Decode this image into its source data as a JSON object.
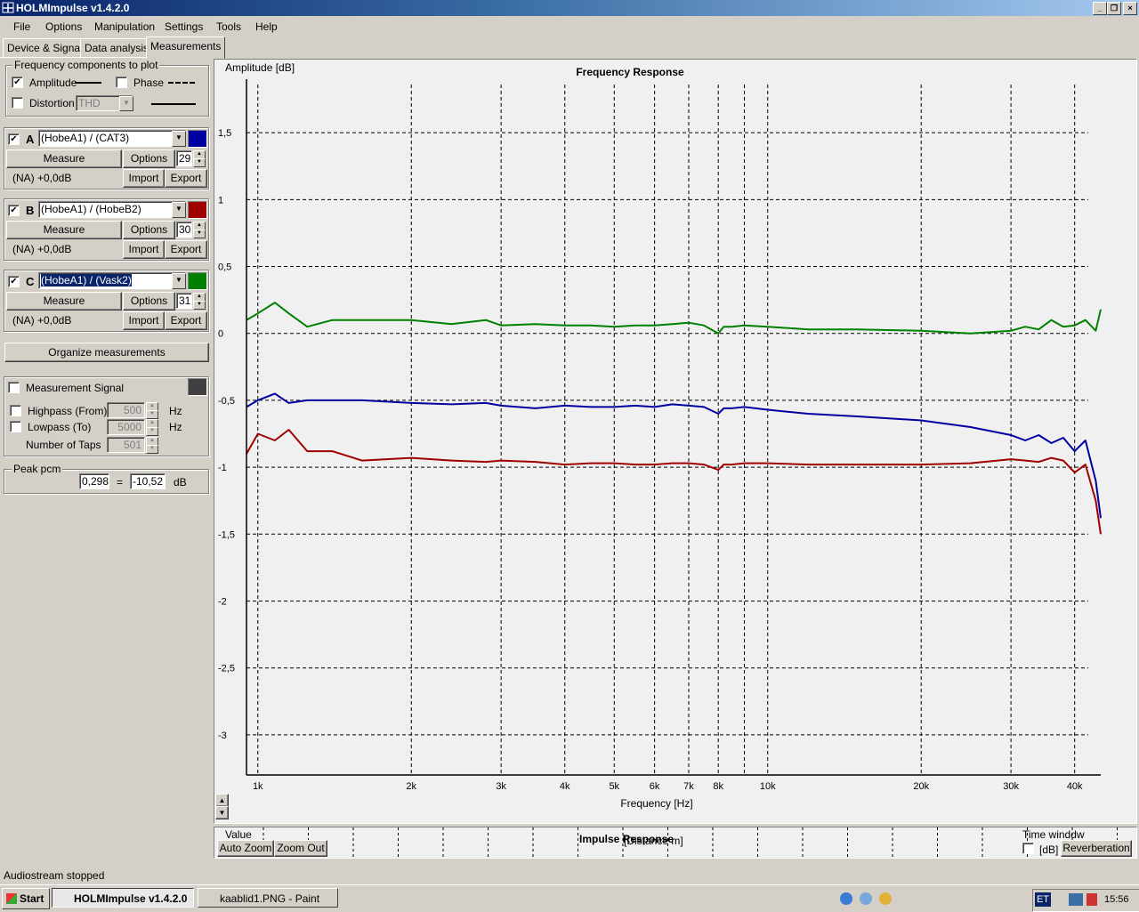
{
  "window": {
    "title": "HOLMImpulse  v1.4.2.0"
  },
  "menu": [
    "File",
    "Options",
    "Manipulation",
    "Settings",
    "Tools",
    "Help"
  ],
  "tabs": [
    "Device & Signal",
    "Data analysis",
    "Measurements"
  ],
  "freq_components": {
    "legend": "Frequency components to plot",
    "amplitude_label": "Amplitude",
    "amplitude_checked": true,
    "phase_label": "Phase",
    "phase_checked": false,
    "distortion_label": "Distortion",
    "distortion_checked": false,
    "distortion_type": "THD"
  },
  "channels": [
    {
      "letter": "A",
      "checked": true,
      "name": "(HobeA1) / (CAT3)",
      "color": "#0000a0",
      "measure": "Measure",
      "options": "Options",
      "count": "29",
      "info": "(NA) +0,0dB",
      "import": "Import",
      "export": "Export"
    },
    {
      "letter": "B",
      "checked": true,
      "name": "(HobeA1) / (HobeB2)",
      "color": "#a00000",
      "measure": "Measure",
      "options": "Options",
      "count": "30",
      "info": "(NA) +0,0dB",
      "import": "Import",
      "export": "Export"
    },
    {
      "letter": "C",
      "checked": true,
      "name": "(HobeA1) / (Vask2)",
      "color": "#008000",
      "measure": "Measure",
      "options": "Options",
      "count": "31",
      "info": "(NA) +0,0dB",
      "import": "Import",
      "export": "Export"
    }
  ],
  "organize_button": "Organize measurements",
  "signal": {
    "label": "Measurement Signal",
    "checked": false,
    "color": "#404040",
    "highpass_label": "Highpass (From)",
    "highpass_value": "500",
    "highpass_unit": "Hz",
    "lowpass_label": "Lowpass (To)",
    "lowpass_value": "5000",
    "lowpass_unit": "Hz",
    "taps_label": "Number of Taps",
    "taps_value": "501"
  },
  "peak": {
    "legend": "Peak pcm",
    "value": "0,298",
    "eq": "=",
    "db_value": "-10,52",
    "unit": "dB"
  },
  "chart_data": {
    "type": "line",
    "title": "Frequency Response",
    "ylabel": "Amplitude [dB]",
    "xlabel": "Frequency [Hz]",
    "x_scale": "log",
    "xlim": [
      1000,
      45000
    ],
    "ylim": [
      -3.3,
      1.9
    ],
    "grid": true,
    "x_ticks": [
      [
        1000,
        "1k"
      ],
      [
        2000,
        "2k"
      ],
      [
        3000,
        "3k"
      ],
      [
        4000,
        "4k"
      ],
      [
        5000,
        "5k"
      ],
      [
        6000,
        "6k"
      ],
      [
        7000,
        "7k"
      ],
      [
        8000,
        "8k"
      ],
      [
        10000,
        "10k"
      ],
      [
        20000,
        "20k"
      ],
      [
        30000,
        "30k"
      ],
      [
        40000,
        "40k"
      ]
    ],
    "y_ticks": [
      [
        1.5,
        "1,5"
      ],
      [
        1,
        "1"
      ],
      [
        0.5,
        "0,5"
      ],
      [
        0,
        "0"
      ],
      [
        -0.5,
        "-0,5"
      ],
      [
        -1,
        "-1"
      ],
      [
        -1.5,
        "-1,5"
      ],
      [
        -2,
        "-2"
      ],
      [
        -2.5,
        "-2,5"
      ],
      [
        -3,
        "-3"
      ]
    ],
    "series": [
      {
        "color": "#008000",
        "x": [
          950,
          1000,
          1080,
          1150,
          1250,
          1400,
          1600,
          2000,
          2400,
          2800,
          3000,
          3500,
          4000,
          4500,
          5000,
          5500,
          6000,
          6500,
          7000,
          7500,
          8000,
          8200,
          8500,
          9000,
          10000,
          12000,
          15000,
          20000,
          25000,
          30000,
          32000,
          34000,
          36000,
          38000,
          40000,
          42000,
          44000,
          45000
        ],
        "y": [
          0.1,
          0.15,
          0.23,
          0.15,
          0.05,
          0.1,
          0.1,
          0.1,
          0.07,
          0.1,
          0.06,
          0.07,
          0.06,
          0.06,
          0.05,
          0.06,
          0.06,
          0.07,
          0.08,
          0.06,
          0.0,
          0.05,
          0.05,
          0.06,
          0.05,
          0.03,
          0.03,
          0.02,
          0.0,
          0.02,
          0.05,
          0.03,
          0.1,
          0.05,
          0.06,
          0.1,
          0.02,
          0.18
        ]
      },
      {
        "color": "#0000a0",
        "x": [
          950,
          1000,
          1080,
          1150,
          1250,
          1400,
          1600,
          2000,
          2400,
          2800,
          3000,
          3500,
          4000,
          4500,
          5000,
          5500,
          6000,
          6500,
          7000,
          7500,
          8000,
          8200,
          8500,
          9000,
          10000,
          12000,
          15000,
          20000,
          25000,
          30000,
          32000,
          34000,
          36000,
          38000,
          40000,
          42000,
          44000,
          45000
        ],
        "y": [
          -0.55,
          -0.5,
          -0.45,
          -0.52,
          -0.5,
          -0.5,
          -0.5,
          -0.52,
          -0.53,
          -0.52,
          -0.54,
          -0.56,
          -0.54,
          -0.55,
          -0.55,
          -0.54,
          -0.55,
          -0.53,
          -0.54,
          -0.55,
          -0.6,
          -0.56,
          -0.56,
          -0.55,
          -0.57,
          -0.6,
          -0.62,
          -0.65,
          -0.7,
          -0.76,
          -0.8,
          -0.76,
          -0.82,
          -0.78,
          -0.88,
          -0.8,
          -1.1,
          -1.38
        ]
      },
      {
        "color": "#a00000",
        "x": [
          950,
          1000,
          1080,
          1150,
          1250,
          1400,
          1600,
          2000,
          2400,
          2800,
          3000,
          3500,
          4000,
          4500,
          5000,
          5500,
          6000,
          6500,
          7000,
          7500,
          8000,
          8200,
          8500,
          9000,
          10000,
          12000,
          15000,
          20000,
          25000,
          30000,
          32000,
          34000,
          36000,
          38000,
          40000,
          42000,
          44000,
          45000
        ],
        "y": [
          -0.9,
          -0.75,
          -0.8,
          -0.72,
          -0.88,
          -0.88,
          -0.95,
          -0.93,
          -0.95,
          -0.96,
          -0.95,
          -0.96,
          -0.98,
          -0.97,
          -0.97,
          -0.98,
          -0.98,
          -0.97,
          -0.97,
          -0.98,
          -1.02,
          -0.98,
          -0.98,
          -0.97,
          -0.97,
          -0.98,
          -0.98,
          -0.98,
          -0.97,
          -0.94,
          -0.95,
          -0.96,
          -0.93,
          -0.95,
          -1.04,
          -0.98,
          -1.25,
          -1.5
        ]
      }
    ]
  },
  "bottom": {
    "value_label": "Value",
    "impulse_label": "Impulse Response",
    "distance_label": "[Distance m]",
    "time_window_label": "Time winddw",
    "db_label": "[dB]",
    "auto_zoom": "Auto Zoom",
    "zoom_out": "Zoom Out",
    "reverberation": "Reverberation"
  },
  "status": {
    "text": "Audiostream stopped"
  },
  "taskbar": {
    "start": "Start",
    "apps": [
      "HOLMImpulse  v1.4.2.0",
      "kaablid1.PNG - Paint"
    ],
    "lang": "ET",
    "time": "15:56"
  }
}
